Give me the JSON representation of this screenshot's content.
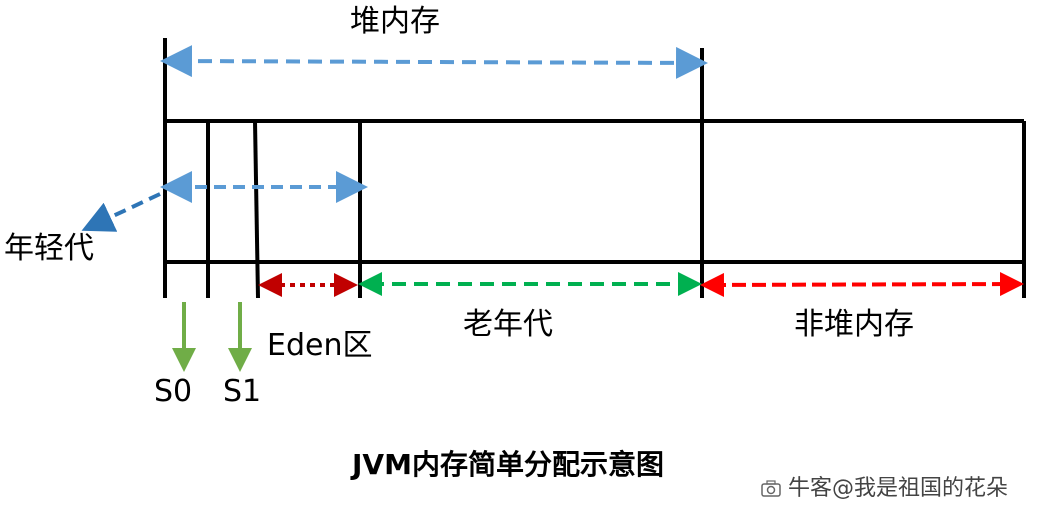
{
  "labels": {
    "heap": "堆内存",
    "young_gen": "年轻代",
    "eden": "Eden区",
    "old_gen": "老年代",
    "non_heap": "非堆内存",
    "s0": "S0",
    "s1": "S1"
  },
  "title": "JVM内存简单分配示意图",
  "watermark": "牛客@我是祖国的花朵",
  "colors": {
    "heap_arrow": "#5b9bd5",
    "young_arrow": "#5b9bd5",
    "young_pointer": "#2e75b6",
    "eden_arrow": "#c00000",
    "old_arrow": "#00b050",
    "non_heap_arrow": "#ff0000",
    "survivor_arrow": "#70ad47",
    "lines": "#000000"
  }
}
